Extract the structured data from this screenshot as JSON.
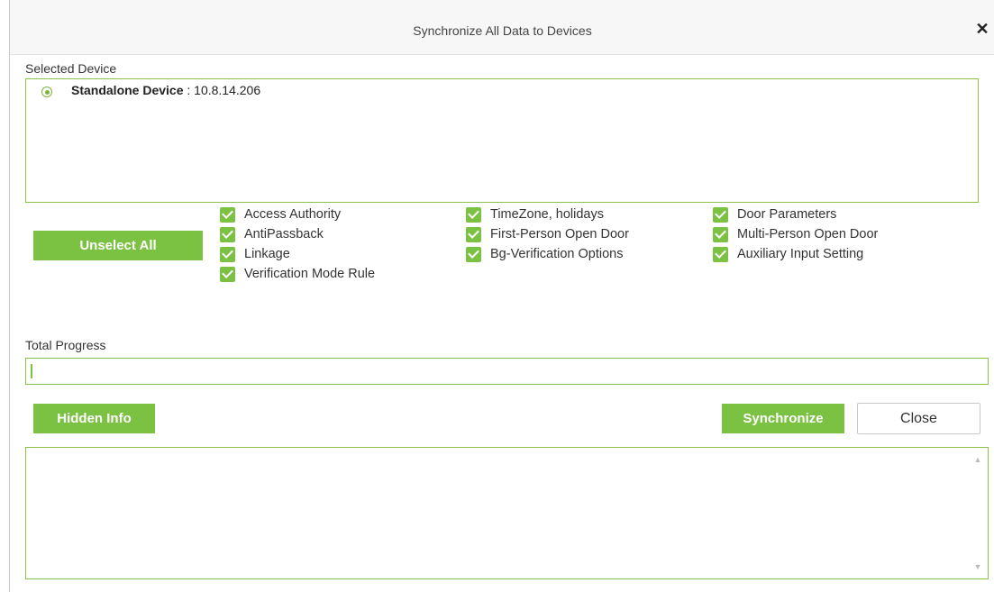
{
  "dialog": {
    "title": "Synchronize All Data to Devices",
    "close_icon": "close-icon"
  },
  "selected_device": {
    "label": "Selected Device",
    "device_type": "Standalone Device",
    "device_ip": " : 10.8.14.206"
  },
  "buttons": {
    "unselect_all": "Unselect All",
    "hidden_info": "Hidden Info",
    "synchronize": "Synchronize",
    "close": "Close"
  },
  "options": [
    {
      "label": "Access Authority",
      "checked": true
    },
    {
      "label": "AntiPassback",
      "checked": true
    },
    {
      "label": "Linkage",
      "checked": true
    },
    {
      "label": "Verification Mode Rule",
      "checked": true
    },
    {
      "label": "TimeZone, holidays",
      "checked": true
    },
    {
      "label": "First-Person Open Door",
      "checked": true
    },
    {
      "label": "Bg-Verification Options",
      "checked": true
    },
    {
      "label": "Door Parameters",
      "checked": true
    },
    {
      "label": "Multi-Person Open Door",
      "checked": true
    },
    {
      "label": "Auxiliary Input Setting",
      "checked": true
    }
  ],
  "progress": {
    "label": "Total Progress",
    "value": 0
  },
  "colors": {
    "accent": "#7cc242",
    "border": "#8bc34a"
  }
}
